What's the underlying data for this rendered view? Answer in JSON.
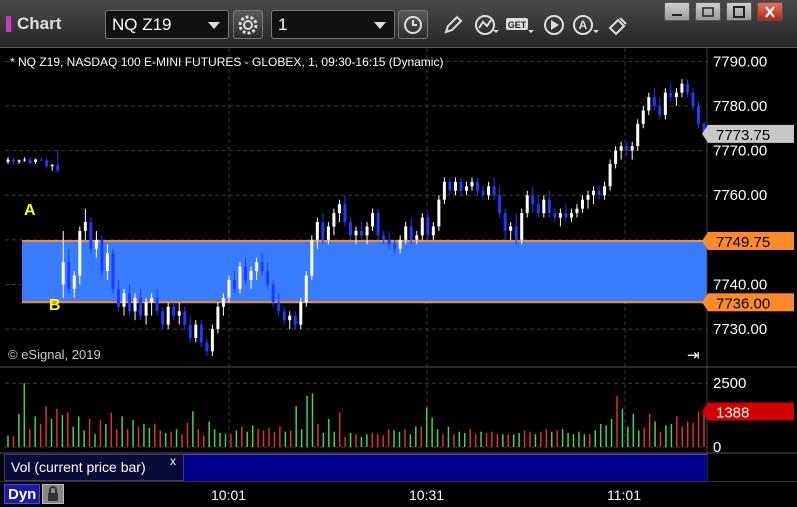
{
  "window": {
    "app_title": "Chart",
    "symbol": "NQ Z19",
    "interval": "1"
  },
  "toolbar_icons": [
    "settings-gear-icon",
    "clock-icon",
    "pencil-icon",
    "study-chart-icon",
    "get-icon",
    "play-icon",
    "alert-icon",
    "link-icon"
  ],
  "chart_data": {
    "type": "candlestick",
    "title": "* NQ Z19, NASDAQ 100 E-MINI FUTURES - GLOBEX, 1, 09:30-16:15 (Dynamic)",
    "copyright": "© eSignal, 2019",
    "y_axis": {
      "ticks": [
        "7790.00",
        "7780.00",
        "7770.00",
        "7760.00",
        "7750.00",
        "7740.00",
        "7730.00"
      ],
      "ylim": [
        7721.5,
        7793
      ],
      "grid": true
    },
    "x_axis": {
      "ticks": [
        "10:01",
        "10:31",
        "11:01"
      ]
    },
    "annotations": {
      "zone": {
        "high": 7749.75,
        "low": 7736.0,
        "high_label": "7749.75",
        "low_label": "7736.00",
        "fill": "#3a7cff",
        "line": "#ff8a2a"
      },
      "labels": [
        "A",
        "B"
      ],
      "last_price": {
        "value": 7773.75,
        "label": "7773.75"
      }
    },
    "candles": [
      [
        7767.5,
        7768.5,
        7767,
        7768
      ],
      [
        7768,
        7768.5,
        7767,
        7767.5
      ],
      [
        7767.5,
        7768,
        7767,
        7767.8
      ],
      [
        7767.8,
        7768.5,
        7767.5,
        7768
      ],
      [
        7768,
        7768.5,
        7767,
        7767.2
      ],
      [
        7767.5,
        7768.2,
        7767,
        7768
      ],
      [
        7768,
        7768.5,
        7767.5,
        7767.8
      ],
      [
        7767.8,
        7768.2,
        7766,
        7766.5
      ],
      [
        7766.5,
        7767,
        7765.5,
        7766.8
      ],
      [
        7766.8,
        7770,
        7765,
        7765.5
      ],
      [
        7740,
        7752,
        7737,
        7745
      ],
      [
        7745,
        7748,
        7738,
        7739
      ],
      [
        7739,
        7743,
        7737,
        7742
      ],
      [
        7742,
        7753,
        7740,
        7752
      ],
      [
        7752,
        7757,
        7750,
        7754
      ],
      [
        7754,
        7755,
        7747,
        7748
      ],
      [
        7748,
        7752,
        7746,
        7750
      ],
      [
        7750,
        7751,
        7742,
        7743
      ],
      [
        7743,
        7749,
        7741,
        7747
      ],
      [
        7747,
        7748,
        7738,
        7739
      ],
      [
        7739,
        7741,
        7734,
        7735
      ],
      [
        7735,
        7739,
        7733,
        7738
      ],
      [
        7738,
        7740,
        7733,
        7734
      ],
      [
        7734,
        7738,
        7732,
        7737
      ],
      [
        7737,
        7739,
        7732,
        7733
      ],
      [
        7733,
        7737,
        7731,
        7736
      ],
      [
        7736,
        7738,
        7733,
        7737
      ],
      [
        7737,
        7739,
        7733,
        7734
      ],
      [
        7734,
        7735,
        7730,
        7731
      ],
      [
        7731,
        7736,
        7730,
        7735
      ],
      [
        7735,
        7736,
        7732,
        7733
      ],
      [
        7733,
        7736,
        7731,
        7734
      ],
      [
        7734,
        7735,
        7730,
        7731
      ],
      [
        7731,
        7733,
        7727,
        7728
      ],
      [
        7728,
        7732,
        7727,
        7731
      ],
      [
        7731,
        7732,
        7726,
        7727
      ],
      [
        7727,
        7728,
        7724,
        7725
      ],
      [
        7725,
        7731,
        7724,
        7730
      ],
      [
        7730,
        7736,
        7729,
        7735
      ],
      [
        7735,
        7738,
        7733,
        7737
      ],
      [
        7737,
        7742,
        7736,
        7741
      ],
      [
        7741,
        7743,
        7738,
        7739
      ],
      [
        7739,
        7745,
        7738,
        7744
      ],
      [
        7744,
        7746,
        7740,
        7741
      ],
      [
        7741,
        7744,
        7739,
        7743
      ],
      [
        7743,
        7746,
        7741,
        7745
      ],
      [
        7745,
        7747,
        7742,
        7743
      ],
      [
        7743,
        7745,
        7739,
        7740
      ],
      [
        7740,
        7741,
        7735,
        7736
      ],
      [
        7736,
        7738,
        7733,
        7734
      ],
      [
        7734,
        7735,
        7731,
        7732
      ],
      [
        7732,
        7734,
        7730,
        7733
      ],
      [
        7733,
        7734,
        7730,
        7731
      ],
      [
        7731,
        7737,
        7730,
        7736
      ],
      [
        7736,
        7743,
        7735,
        7742
      ],
      [
        7742,
        7751,
        7741,
        7750
      ],
      [
        7750,
        7755,
        7748,
        7754
      ],
      [
        7754,
        7756,
        7749,
        7750
      ],
      [
        7750,
        7754,
        7749,
        7753
      ],
      [
        7753,
        7757,
        7751,
        7756
      ],
      [
        7756,
        7759,
        7754,
        7758
      ],
      [
        7758,
        7760,
        7753,
        7754
      ],
      [
        7754,
        7755,
        7750,
        7751
      ],
      [
        7751,
        7753,
        7749,
        7752
      ],
      [
        7752,
        7754,
        7750,
        7751
      ],
      [
        7751,
        7754,
        7749,
        7753
      ],
      [
        7753,
        7757,
        7752,
        7756
      ],
      [
        7756,
        7757,
        7750,
        7751
      ],
      [
        7751,
        7752,
        7749,
        7750
      ],
      [
        7750,
        7752,
        7748,
        7749
      ],
      [
        7749,
        7750,
        7747,
        7748
      ],
      [
        7748,
        7751,
        7747,
        7750
      ],
      [
        7750,
        7754,
        7749,
        7753
      ],
      [
        7753,
        7755,
        7749,
        7750
      ],
      [
        7750,
        7752,
        7749,
        7751
      ],
      [
        7751,
        7756,
        7750,
        7755
      ],
      [
        7755,
        7756,
        7750,
        7751
      ],
      [
        7751,
        7754,
        7750,
        7753
      ],
      [
        7753,
        7760,
        7752,
        7759
      ],
      [
        7759,
        7764,
        7758,
        7763
      ],
      [
        7763,
        7764,
        7760,
        7761
      ],
      [
        7761,
        7764,
        7760,
        7763
      ],
      [
        7763,
        7764,
        7760,
        7761
      ],
      [
        7761,
        7763,
        7760,
        7762
      ],
      [
        7762,
        7764,
        7761,
        7763
      ],
      [
        7763,
        7764,
        7760,
        7761
      ],
      [
        7761,
        7762,
        7759,
        7760
      ],
      [
        7760,
        7763,
        7759,
        7762
      ],
      [
        7762,
        7764,
        7759,
        7760
      ],
      [
        7760,
        7762,
        7755,
        7756
      ],
      [
        7756,
        7757,
        7750,
        7752
      ],
      [
        7752,
        7754,
        7750,
        7753
      ],
      [
        7753,
        7756,
        7749,
        7750
      ],
      [
        7750,
        7757,
        7749,
        7756
      ],
      [
        7756,
        7761,
        7755,
        7760
      ],
      [
        7760,
        7762,
        7756,
        7758
      ],
      [
        7758,
        7760,
        7755,
        7756
      ],
      [
        7756,
        7760,
        7755,
        7759
      ],
      [
        7759,
        7761,
        7755,
        7756
      ],
      [
        7756,
        7757,
        7754,
        7755
      ],
      [
        7755,
        7757,
        7753,
        7756
      ],
      [
        7756,
        7758,
        7754,
        7755
      ],
      [
        7755,
        7757,
        7754,
        7756
      ],
      [
        7756,
        7758,
        7755,
        7757
      ],
      [
        7757,
        7760,
        7756,
        7759
      ],
      [
        7759,
        7761,
        7757,
        7760
      ],
      [
        7760,
        7762,
        7758,
        7761
      ],
      [
        7761,
        7762,
        7759,
        7760
      ],
      [
        7760,
        7763,
        7759,
        7762
      ],
      [
        7762,
        7768,
        7761,
        7767
      ],
      [
        7767,
        7771,
        7766,
        7770
      ],
      [
        7770,
        7772,
        7768,
        7771
      ],
      [
        7771,
        7772,
        7769,
        7770
      ],
      [
        7770,
        7772,
        7768,
        7771
      ],
      [
        7771,
        7777,
        7770,
        7776
      ],
      [
        7776,
        7780,
        7775,
        7779
      ],
      [
        7779,
        7783,
        7778,
        7782
      ],
      [
        7782,
        7784,
        7779,
        7780
      ],
      [
        7780,
        7782,
        7777,
        7778
      ],
      [
        7778,
        7784,
        7777,
        7783
      ],
      [
        7783,
        7785,
        7781,
        7782
      ],
      [
        7782,
        7784,
        7780,
        7783
      ],
      [
        7783,
        7786,
        7782,
        7785
      ],
      [
        7785,
        7786,
        7782,
        7783
      ],
      [
        7783,
        7784,
        7779,
        7780
      ],
      [
        7780,
        7781,
        7775,
        7776
      ],
      [
        7776,
        7776.5,
        7773,
        7773.75
      ]
    ]
  },
  "volume_panel": {
    "legend": "Vol (current price bar)",
    "close_symbol": "x",
    "y_ticks": [
      "2500",
      "0"
    ],
    "last_value": {
      "value": 1388,
      "label": "1388"
    },
    "values": [
      450,
      420,
      1300,
      2500,
      700,
      1200,
      900,
      1600,
      1100,
      1500,
      1250,
      1350,
      800,
      1200,
      650,
      1100,
      500,
      1050,
      900,
      1350,
      700,
      1200,
      700,
      1050,
      800,
      900,
      750,
      900,
      650,
      550,
      600,
      700,
      500,
      950,
      1400,
      700,
      450,
      1000,
      700,
      550,
      500,
      500,
      650,
      800,
      600,
      850,
      700,
      650,
      750,
      600,
      800,
      600,
      650,
      1600,
      700,
      2000,
      2100,
      900,
      550,
      1100,
      600,
      1350,
      400,
      550,
      500,
      400,
      500,
      550,
      500,
      450,
      700,
      650,
      600,
      700,
      500,
      800,
      800,
      1550,
      1150,
      700,
      500,
      800,
      500,
      600,
      550,
      700,
      500,
      600,
      550,
      600,
      500,
      500,
      500,
      500,
      550,
      650,
      600,
      500,
      600,
      700,
      600,
      650,
      700,
      550,
      500,
      600,
      500,
      500,
      650,
      900,
      850,
      1100,
      2000,
      1500,
      800,
      1300,
      650,
      750,
      1300,
      1000,
      600,
      850,
      900,
      1200,
      800,
      1000,
      950,
      1388,
      1388
    ]
  },
  "footer": {
    "mode": "Dyn",
    "lock_icon": "lock-icon",
    "scroll_icon": "scroll-to-end-icon"
  }
}
